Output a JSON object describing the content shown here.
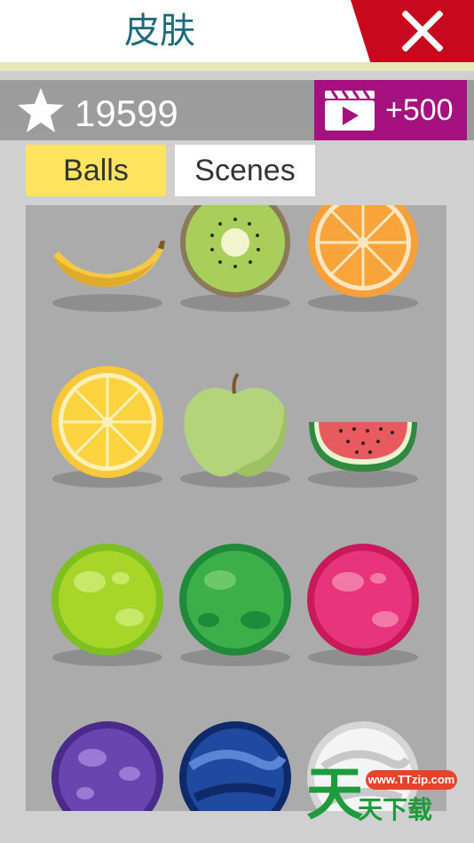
{
  "header": {
    "title": "皮肤"
  },
  "currency": {
    "score": "19599",
    "reward_label": "+500"
  },
  "tabs": [
    {
      "label": "Balls",
      "selected": true
    },
    {
      "label": "Scenes",
      "selected": false
    }
  ],
  "skins": [
    {
      "name": "banana"
    },
    {
      "name": "kiwi"
    },
    {
      "name": "orange"
    },
    {
      "name": "lemon"
    },
    {
      "name": "green-apple"
    },
    {
      "name": "watermelon"
    },
    {
      "name": "lime-ball"
    },
    {
      "name": "green-ball"
    },
    {
      "name": "pink-ball"
    },
    {
      "name": "purple-ball"
    },
    {
      "name": "blue-ball"
    },
    {
      "name": "white-ball"
    }
  ],
  "watermark": {
    "url": "www.TTzip.com",
    "big": "天",
    "small": "天下载"
  },
  "colors": {
    "close": "#c8081c",
    "ad": "#a5127f",
    "tab_selected": "#fde35e",
    "title": "#1f6a7a"
  }
}
